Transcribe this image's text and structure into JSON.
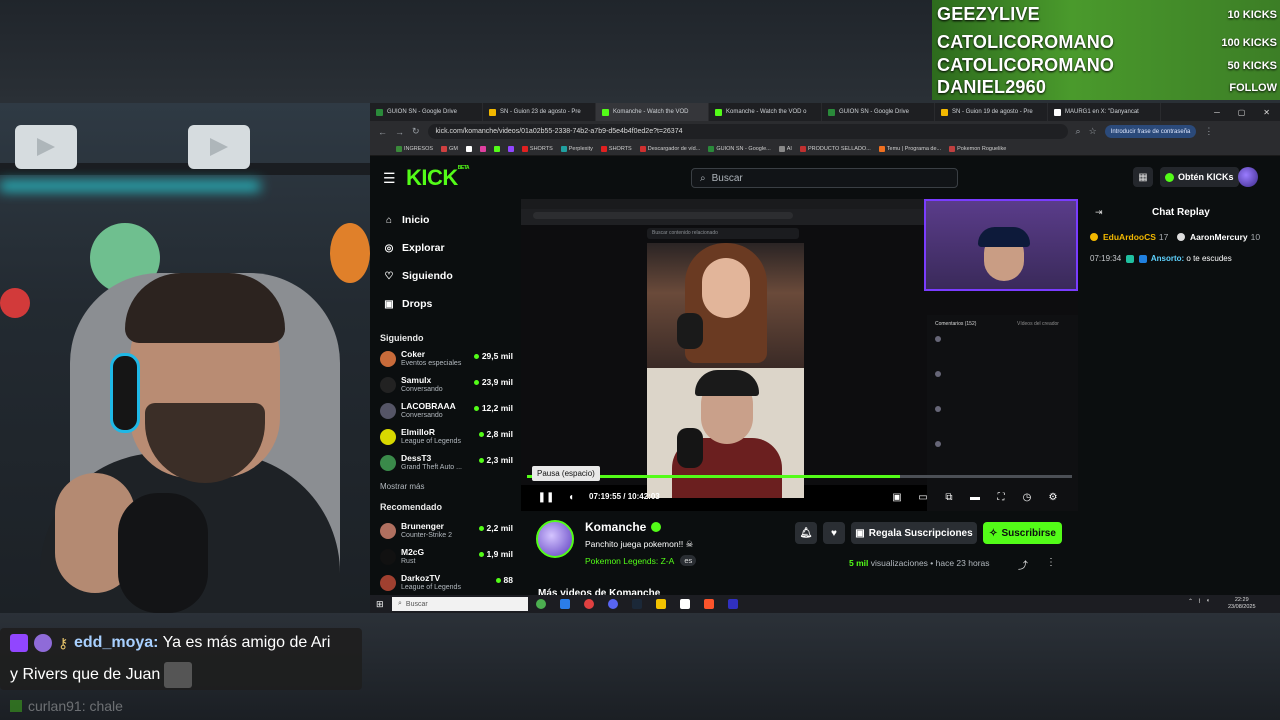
{
  "kicks_panel": {
    "rows": [
      {
        "user": "GEEZYLIVE",
        "amount": "10 KICKS"
      },
      {
        "user": "CATOLICOROMANO",
        "amount": "100 KICKS"
      },
      {
        "user": "CATOLICOROMANO",
        "amount": "50 KICKS"
      },
      {
        "user": "DANIEL2960",
        "amount": "FOLLOW"
      }
    ]
  },
  "overlay_chat": {
    "user": "edd_moya:",
    "message_line1": " Ya es más amigo de Ari",
    "message_line2": "y Rivers que de Juan",
    "faded_line": "curlan91: chale"
  },
  "browser": {
    "tabs": [
      {
        "label": "GUION SN - Google Drive",
        "color": "#2a8a3a"
      },
      {
        "label": "SN - Guion 23 de agosto - Pre",
        "color": "#f2b800"
      },
      {
        "label": "Komanche - Watch the VOD",
        "color": "#53fc18",
        "active": true
      },
      {
        "label": "Komanche - Watch the VOD o",
        "color": "#53fc18"
      },
      {
        "label": "GUION SN - Google Drive",
        "color": "#2a8a3a"
      },
      {
        "label": "SN - Guion 19 de agosto - Pre",
        "color": "#f2b800"
      },
      {
        "label": "MAURG1 en X: \"Danyancat",
        "color": "#ffffff"
      }
    ],
    "url": "kick.com/komanche/videos/01a02b55-2338-74b2-a7b9-d5e4b4f0ed2e?t=26374",
    "password_button": "Introducir frase de contraseña",
    "bookmarks": [
      "INGRESOS",
      "GM",
      "SHORTS",
      "Perplexity",
      "SHORTS",
      "Descargador de víd...",
      "GUION SN - Google...",
      "AI",
      "PRODUCTO SELLADO...",
      "Temu | Programa de...",
      "Pokemon Roguelike"
    ]
  },
  "kick": {
    "search_placeholder": "Buscar",
    "get_kicks": "Obtén KICKs",
    "nav": [
      {
        "label": "Inicio",
        "icon": "home-icon"
      },
      {
        "label": "Explorar",
        "icon": "compass-icon"
      },
      {
        "label": "Siguiendo",
        "icon": "heart-icon"
      },
      {
        "label": "Drops",
        "icon": "gift-icon"
      }
    ],
    "following_header": "Siguiendo",
    "following": [
      {
        "name": "Coker",
        "category": "Eventos especiales",
        "viewers": "29,5 mil",
        "color": "#c86b3a"
      },
      {
        "name": "Samulx",
        "category": "Conversando",
        "viewers": "23,9 mil",
        "color": "#222222"
      },
      {
        "name": "LACOBRAAA",
        "category": "Conversando",
        "viewers": "12,2 mil",
        "color": "#555566"
      },
      {
        "name": "ElmilloR",
        "category": "League of Legends",
        "viewers": "2,8 mil",
        "color": "#d8d800"
      },
      {
        "name": "DessT3",
        "category": "Grand Theft Auto ...",
        "viewers": "2,3 mil",
        "color": "#3a8a4a"
      }
    ],
    "show_more": "Mostrar más",
    "recommended_header": "Recomendado",
    "recommended": [
      {
        "name": "Brunenger",
        "category": "Counter-Strike 2",
        "viewers": "2,2 mil",
        "color": "#b07060"
      },
      {
        "name": "M2cG",
        "category": "Rust",
        "viewers": "1,9 mil",
        "color": "#111111"
      },
      {
        "name": "DarkozTV",
        "category": "League of Legends",
        "viewers": "88",
        "color": "#a04030"
      }
    ],
    "player": {
      "inner_search": "Buscar contenido relacionado",
      "comments_tab1": "Comentarios (152)",
      "comments_tab2": "Vídeos del creador",
      "tooltip": "Pausa (espacio)",
      "time": "07:19:55  /  10:42:03",
      "progress": 0.684
    },
    "chat_replay": {
      "title": "Chat Replay",
      "gifters": [
        {
          "name": "EduArdooCS",
          "count": "17",
          "color": "#f2b800"
        },
        {
          "name": "AaronMercury",
          "count": "10",
          "color": "#dddddd"
        }
      ],
      "message": {
        "time": "07:19:34",
        "user": "Ansorto:",
        "text": " o te escudes"
      }
    },
    "channel": {
      "name": "Komanche",
      "title": "Panchito juega pokemon!! ☠",
      "category": "Pokemon Legends: Z-A",
      "language": "es",
      "gift_subs": "Regala Suscripciones",
      "subscribe": "Suscribirse",
      "views": "5 mil",
      "views_label": "visualizaciones",
      "ago": "hace 23 horas",
      "more_videos": "Más videos de Komanche"
    }
  },
  "taskbar": {
    "search": "Buscar",
    "time": "22:29",
    "date": "23/08/2025"
  }
}
